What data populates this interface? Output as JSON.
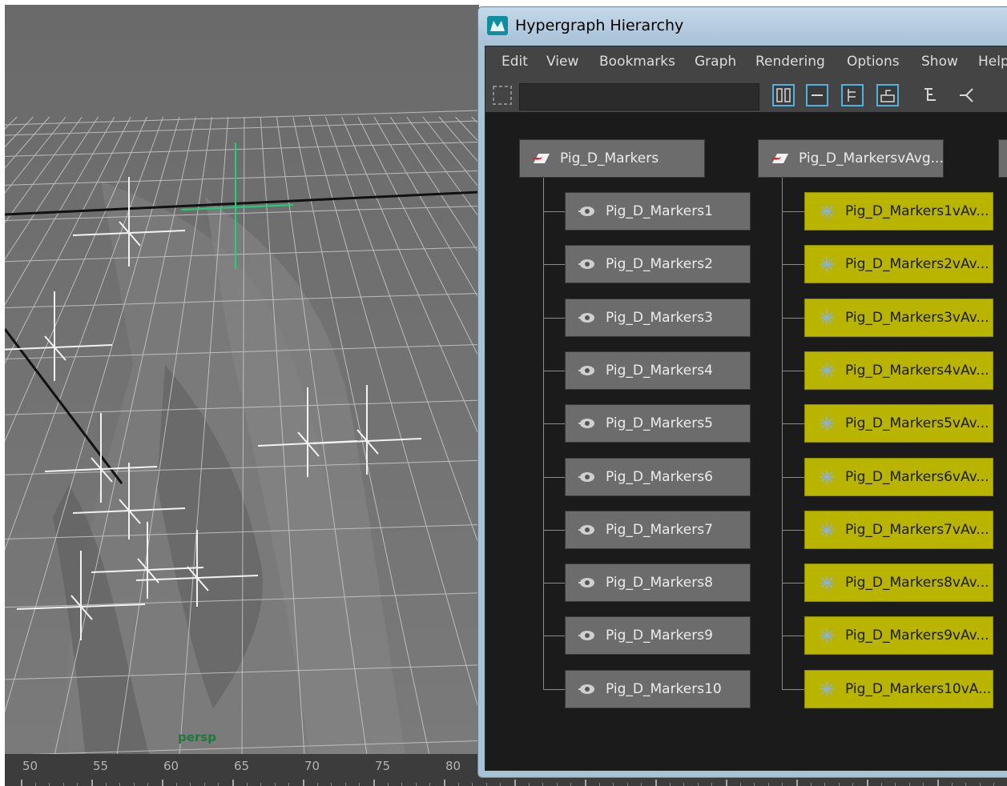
{
  "viewport": {
    "camera_label": "persp",
    "timeline_ticks": [
      "50",
      "55",
      "60",
      "65",
      "70",
      "75",
      "80"
    ]
  },
  "window": {
    "title": "Hypergraph Hierarchy",
    "menu": [
      "Edit",
      "View",
      "Bookmarks",
      "Graph",
      "Rendering",
      "Options",
      "Show",
      "Help"
    ],
    "search_value": ""
  },
  "graph": {
    "parents": [
      {
        "label": "Pig_D_Markers",
        "icon": "group-transform-icon",
        "children": [
          "Pig_D_Markers1",
          "Pig_D_Markers2",
          "Pig_D_Markers3",
          "Pig_D_Markers4",
          "Pig_D_Markers5",
          "Pig_D_Markers6",
          "Pig_D_Markers7",
          "Pig_D_Markers8",
          "Pig_D_Markers9",
          "Pig_D_Markers10"
        ],
        "child_icon": "locator-eye-icon",
        "child_color": "#6c6c6c"
      },
      {
        "label": "Pig_D_MarkersvAvg...",
        "icon": "group-transform-icon",
        "children": [
          "Pig_D_Markers1vAv...",
          "Pig_D_Markers2vAv...",
          "Pig_D_Markers3vAv...",
          "Pig_D_Markers4vAv...",
          "Pig_D_Markers5vAv...",
          "Pig_D_Markers6vAv...",
          "Pig_D_Markers7vAv...",
          "Pig_D_Markers8vAv...",
          "Pig_D_Markers9vAv...",
          "Pig_D_Markers10vA..."
        ],
        "child_icon": "star-locator-icon",
        "child_color": "#b8b400"
      }
    ]
  },
  "colors": {
    "selected_node": "#b8b400",
    "node": "#6c6c6c",
    "graph_bg": "#1b1b1b",
    "camera_label": "#1d7a3a"
  }
}
